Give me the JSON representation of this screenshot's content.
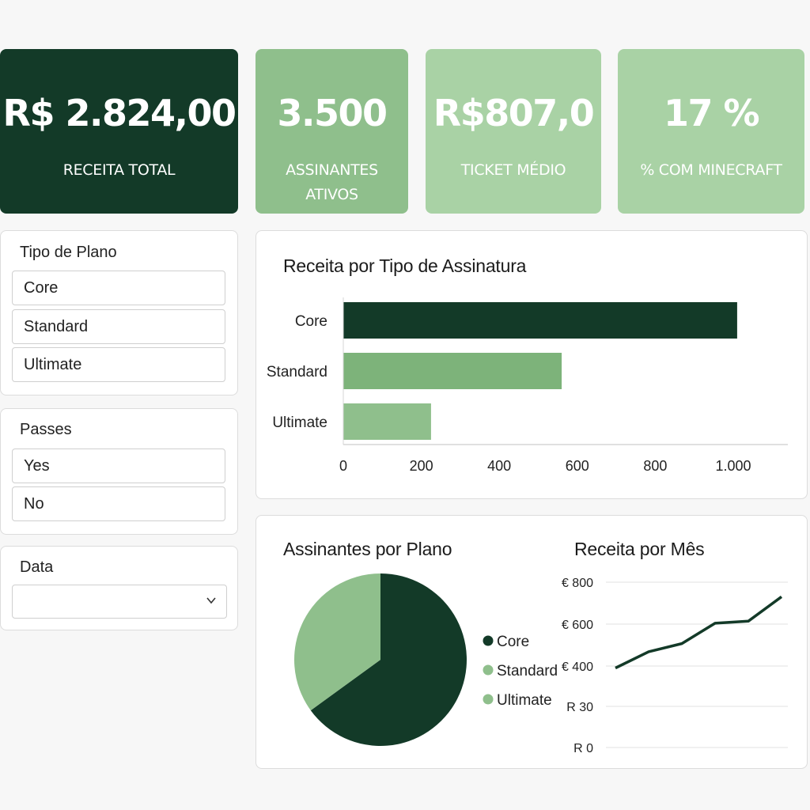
{
  "kpis": [
    {
      "value": "R$ 2.824,00",
      "label": "RECEITA TOTAL"
    },
    {
      "value": "3.500",
      "label": "ASSINANTES ATIVOS"
    },
    {
      "value": "R$807,0",
      "label": "TICKET MÉDIO"
    },
    {
      "value": "17 %",
      "label": "% COM MINECRAFT"
    }
  ],
  "filters": {
    "plan": {
      "title": "Tipo de Plano",
      "options": [
        "Core",
        "Standard",
        "Ultimate"
      ]
    },
    "passes": {
      "title": "Passes",
      "options": [
        "Yes",
        "No"
      ]
    },
    "date": {
      "title": "Data",
      "value": "",
      "icon": "chevron-down-icon"
    }
  },
  "colors": {
    "dark_green": "#133a28",
    "mid_green": "#7db37a",
    "light_green": "#8fbf8c",
    "pale_green": "#a9d2a5"
  },
  "chart_data": [
    {
      "type": "bar",
      "orientation": "horizontal",
      "title": "Receita por Tipo de Assinatura",
      "categories": [
        "Core",
        "Standard",
        "Ultimate"
      ],
      "values": [
        1010,
        560,
        225
      ],
      "colors": [
        "#133a28",
        "#7db37a",
        "#8fbf8c"
      ],
      "xlim": [
        0,
        1140
      ],
      "xticks": [
        0,
        200,
        400,
        600,
        800,
        1000
      ],
      "xtick_labels": [
        "0",
        "200",
        "400",
        "600",
        "800",
        "1.000"
      ],
      "grid": false
    },
    {
      "type": "pie",
      "title": "Assinantes por Plano",
      "labels": [
        "Core",
        "Standard",
        "Ultimate"
      ],
      "values": [
        65,
        0,
        35
      ],
      "colors": [
        "#133a28",
        "#8fbf8c",
        "#8fbf8c"
      ],
      "legend": "right"
    },
    {
      "type": "line",
      "title": "Receita por Mês",
      "y_tick_labels": [
        "€ 800",
        "€ 600",
        "€ 400",
        "R 30",
        "R 0"
      ],
      "x": [
        1,
        2,
        3,
        4,
        5,
        6
      ],
      "values": [
        410,
        490,
        530,
        630,
        640,
        760
      ],
      "ylim": [
        0,
        800
      ],
      "grid": true,
      "color": "#133a28"
    }
  ]
}
